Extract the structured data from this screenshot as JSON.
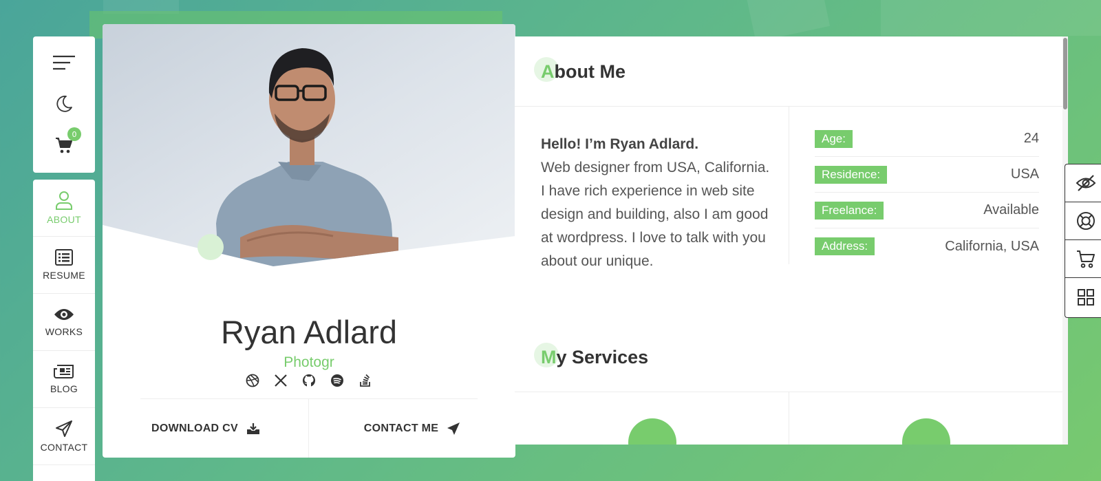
{
  "toolbar": {
    "cart_count": "0",
    "icons": [
      "menu-icon",
      "moon-icon",
      "cart-icon"
    ]
  },
  "nav": {
    "items": [
      {
        "label": "ABOUT",
        "icon": "user-icon",
        "active": true
      },
      {
        "label": "RESUME",
        "icon": "list-icon",
        "active": false
      },
      {
        "label": "WORKS",
        "icon": "eye-icon",
        "active": false
      },
      {
        "label": "BLOG",
        "icon": "newspaper-icon",
        "active": false
      },
      {
        "label": "CONTACT",
        "icon": "paper-plane-icon",
        "active": false
      }
    ]
  },
  "profile": {
    "name": "Ryan Adlard",
    "role": "Photogr",
    "socials": [
      "dribbble-icon",
      "x-icon",
      "github-icon",
      "spotify-icon",
      "stackoverflow-icon"
    ],
    "download_label": "DOWNLOAD CV",
    "contact_label": "CONTACT ME"
  },
  "about": {
    "title_first": "A",
    "title_rest": "bout Me",
    "greeting": "Hello! I’m Ryan Adlard.",
    "bio": "Web designer from USA, California. I have rich experience in web site design and building, also I am good at wordpress. I love to talk with you about our unique.",
    "info": [
      {
        "key": "Age:",
        "value": "24"
      },
      {
        "key": "Residence:",
        "value": "USA"
      },
      {
        "key": "Freelance:",
        "value": "Available"
      },
      {
        "key": "Address:",
        "value": "California, USA"
      }
    ]
  },
  "services": {
    "title_first": "M",
    "title_rest": "y Services"
  },
  "dock": {
    "icons": [
      "eye-slash-icon",
      "lifebuoy-icon",
      "cart-icon",
      "grid-icon"
    ]
  },
  "colors": {
    "accent": "#78cc6d",
    "text": "#333333"
  }
}
